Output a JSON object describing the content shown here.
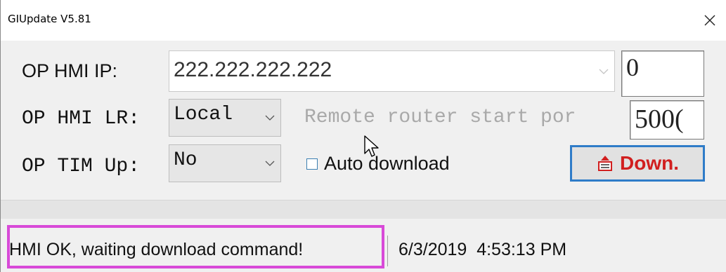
{
  "window": {
    "title": "GIUpdate V5.81"
  },
  "icons": {
    "close": "close-icon",
    "combo_arrow": "chevron-down-icon",
    "download": "download-icon",
    "cursor": "mouse-pointer-icon"
  },
  "form": {
    "ip_label": "OP HMI IP:",
    "ip_value": "222.222.222.222",
    "ip_index": "0",
    "lr_label": "OP HMI LR:",
    "lr_value": "Local",
    "remote_label": "Remote router start por",
    "port_value": "500(",
    "tim_label": "OP TIM Up:",
    "tim_value": "No",
    "auto_download_label": "Auto download",
    "auto_download_checked": false,
    "download_button": "Down."
  },
  "status": {
    "message": "HMI OK, waiting download command!",
    "datetime": "6/3/2019  4:53:13 PM"
  },
  "colors": {
    "highlight": "#d84ad8",
    "button_border": "#2f7cc8",
    "button_text": "#d11f1f",
    "disabled_text": "#a9a9a9"
  }
}
